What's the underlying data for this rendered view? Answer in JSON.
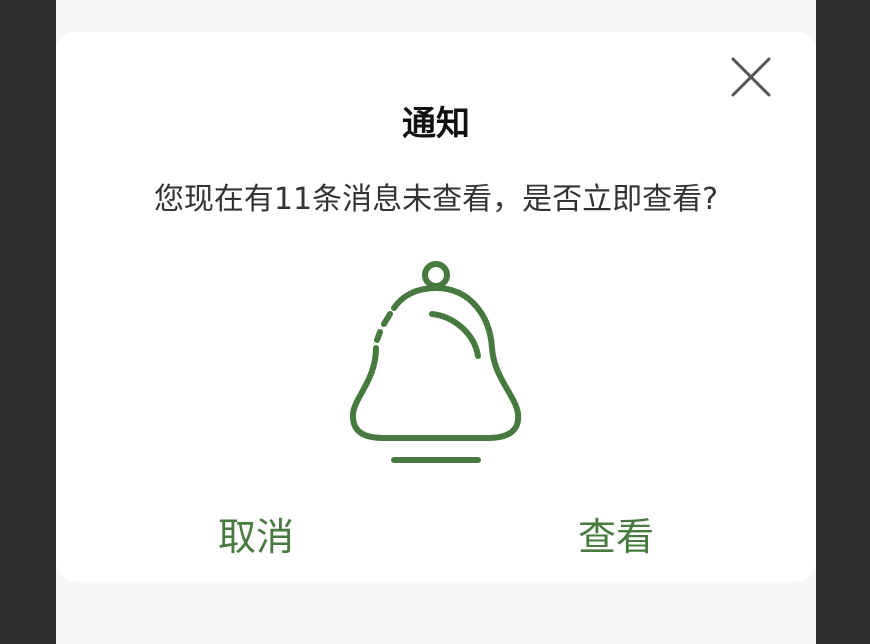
{
  "dialog": {
    "title": "通知",
    "message": "您现在有11条消息未查看，是否立即查看?",
    "cancel_label": "取消",
    "view_label": "查看",
    "close_icon": "close-icon",
    "illustration_icon": "bell-icon"
  },
  "colors": {
    "accent": "#467a3e",
    "overlay_side": "#2d2d2f",
    "screen_background": "#f7f7f7",
    "dialog_background": "#ffffff",
    "title_text": "#111111",
    "body_text": "#333333"
  }
}
